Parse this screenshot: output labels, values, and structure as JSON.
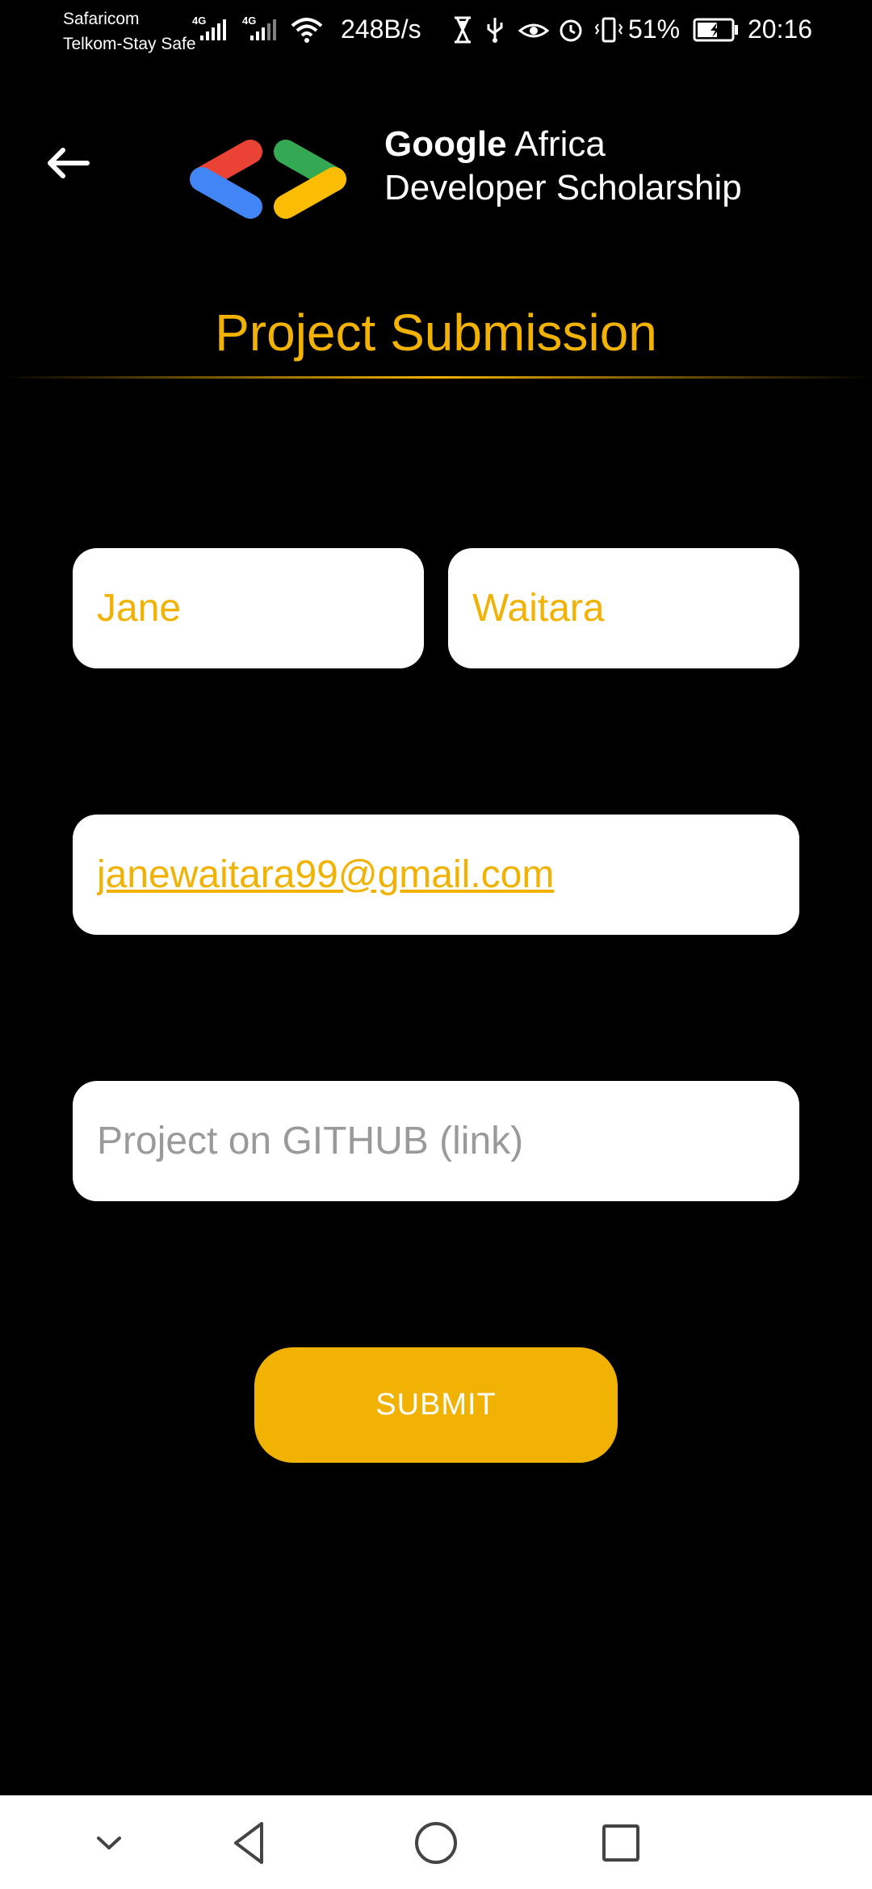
{
  "status_bar": {
    "carrier_1": "Safaricom",
    "carrier_2": "Telkom-Stay Safe",
    "network_1": "4G",
    "network_2": "4G",
    "net_speed": "248B/s",
    "battery": "51%",
    "time": "20:16"
  },
  "header": {
    "brand_google": "Google",
    "brand_africa": "Africa",
    "brand_line2": "Developer Scholarship",
    "logo_colors": [
      "#ea4335",
      "#4285f4",
      "#34a853",
      "#fbbc04"
    ]
  },
  "page": {
    "title": "Project Submission"
  },
  "form": {
    "first_name": "Jane",
    "last_name": "Waitara",
    "email": "janewaitara99@gmail.com",
    "github_placeholder": "Project on GITHUB (link)",
    "github_value": "",
    "submit_label": "SUBMIT"
  },
  "colors": {
    "accent": "#f2b203",
    "background": "#000000",
    "field_background": "#ffffff",
    "placeholder": "#9a9a9a"
  },
  "icons": {
    "back": "arrow-left-icon",
    "nav": [
      "chevron-down-icon",
      "back-triangle-icon",
      "home-circle-icon",
      "recents-square-icon"
    ]
  }
}
